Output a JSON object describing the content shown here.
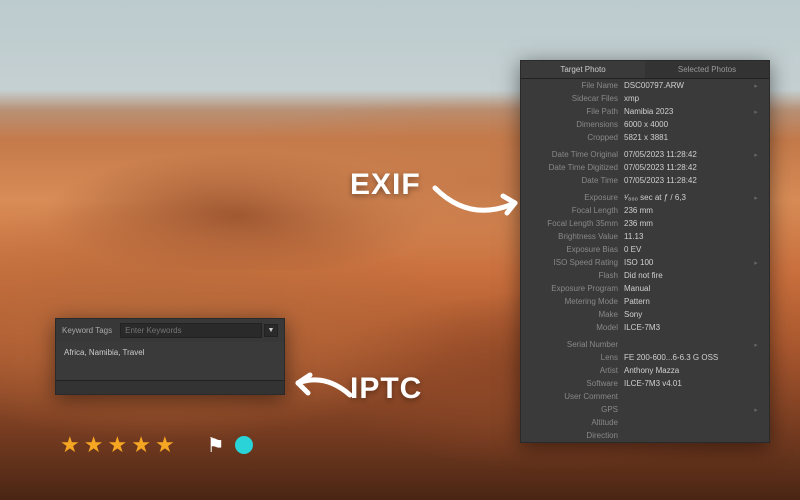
{
  "annotations": {
    "exif": "EXIF",
    "iptc": "IPTC"
  },
  "exif_panel": {
    "tabs": [
      "Target Photo",
      "Selected Photos"
    ],
    "active_tab": 0,
    "file": {
      "file_name_label": "File Name",
      "file_name": "DSC00797.ARW",
      "sidecar_label": "Sidecar Files",
      "sidecar": "xmp",
      "file_path_label": "File Path",
      "file_path": "Namibia 2023",
      "dimensions_label": "Dimensions",
      "dimensions": "6000 x 4000",
      "cropped_label": "Cropped",
      "cropped": "5821 x 3881"
    },
    "dates": {
      "original_label": "Date Time Original",
      "original": "07/05/2023 11:28:42",
      "digitized_label": "Date Time Digitized",
      "digitized": "07/05/2023 11:28:42",
      "datetime_label": "Date Time",
      "datetime": "07/05/2023 11:28:42"
    },
    "exposure": {
      "exposure_label": "Exposure",
      "exposure": "¹⁄₈₀₀ sec at ƒ / 6,3",
      "focal_label": "Focal Length",
      "focal": "236 mm",
      "focal35_label": "Focal Length 35mm",
      "focal35": "236 mm",
      "brightness_label": "Brightness Value",
      "brightness": "11.13",
      "bias_label": "Exposure Bias",
      "bias": "0 EV",
      "iso_label": "ISO Speed Rating",
      "iso": "ISO 100",
      "flash_label": "Flash",
      "flash": "Did not fire",
      "program_label": "Exposure Program",
      "program": "Manual",
      "metering_label": "Metering Mode",
      "metering": "Pattern",
      "make_label": "Make",
      "make": "Sony",
      "model_label": "Model",
      "model": "ILCE-7M3"
    },
    "other": {
      "serial_label": "Serial Number",
      "serial": "",
      "lens_label": "Lens",
      "lens": "FE 200-600...6-6.3 G OSS",
      "artist_label": "Artist",
      "artist": "Anthony Mazza",
      "software_label": "Software",
      "software": "ILCE-7M3 v4.01",
      "comment_label": "User Comment",
      "comment": "",
      "gps_label": "GPS",
      "gps": "",
      "altitude_label": "Altitude",
      "altitude": "",
      "direction_label": "Direction",
      "direction": ""
    }
  },
  "iptc_panel": {
    "label": "Keyword Tags",
    "placeholder": "Enter Keywords",
    "keywords": "Africa, Namibia, Travel"
  },
  "rating": {
    "stars": 5,
    "flagged": true,
    "color_label": "cyan"
  }
}
